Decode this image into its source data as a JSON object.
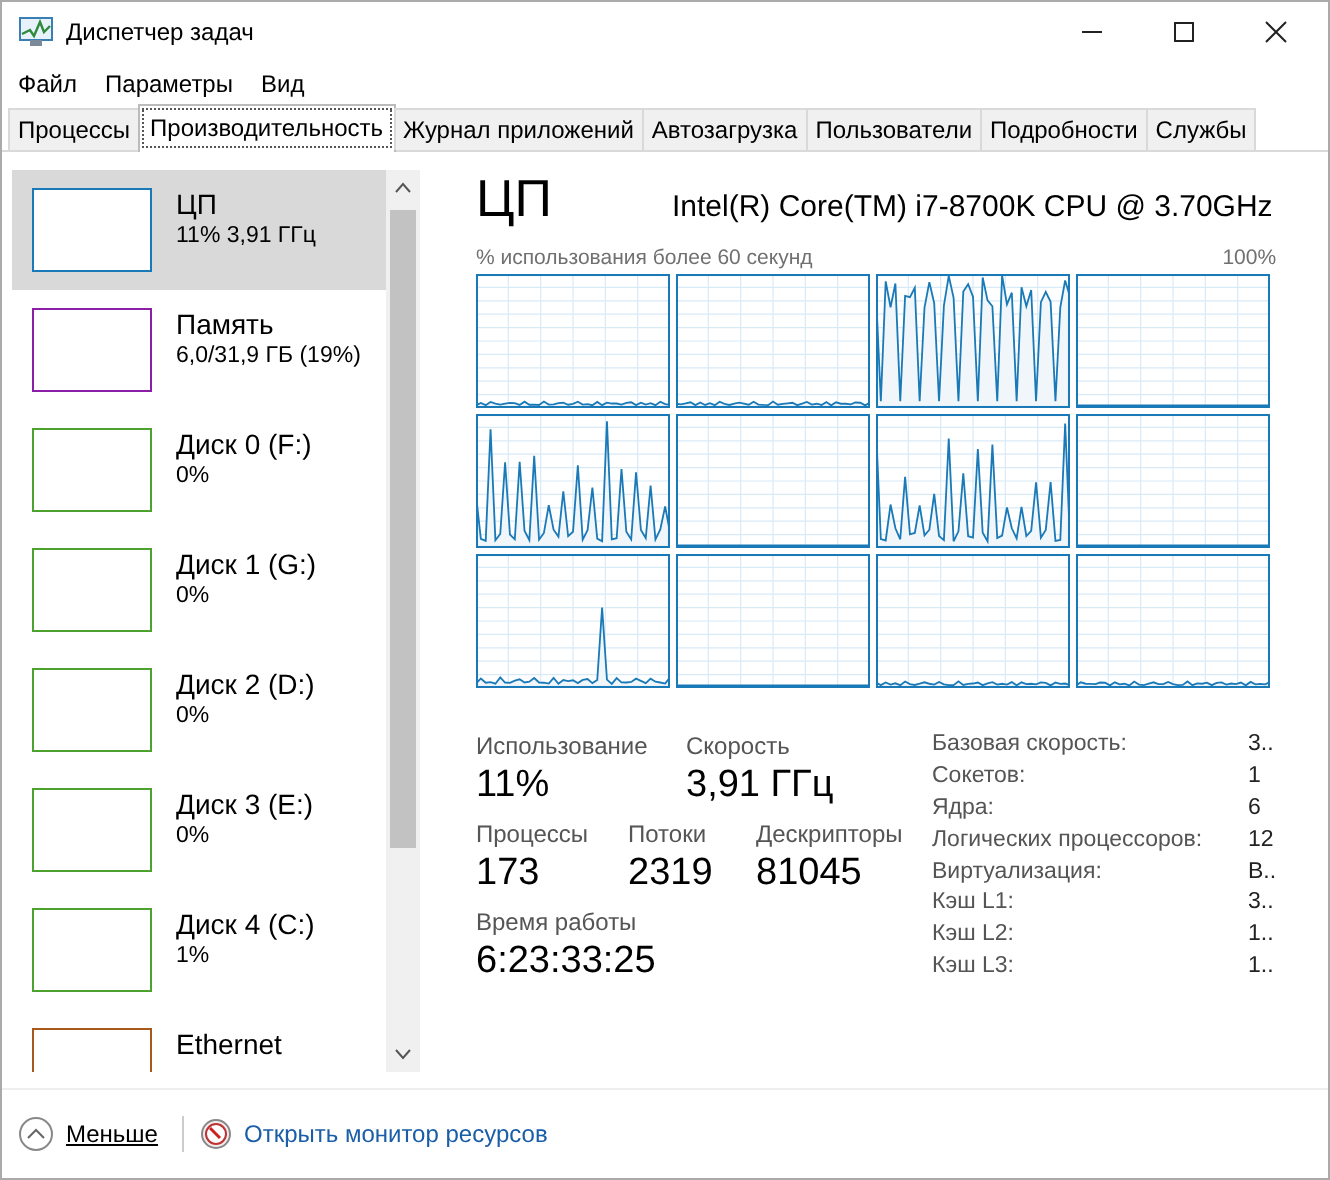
{
  "window": {
    "title": "Диспетчер задач"
  },
  "menu": [
    "Файл",
    "Параметры",
    "Вид"
  ],
  "tabs": [
    {
      "label": "Процессы",
      "selected": false
    },
    {
      "label": "Производительность",
      "selected": true
    },
    {
      "label": "Журнал приложений",
      "selected": false
    },
    {
      "label": "Автозагрузка",
      "selected": false
    },
    {
      "label": "Пользователи",
      "selected": false
    },
    {
      "label": "Подробности",
      "selected": false
    },
    {
      "label": "Службы",
      "selected": false
    }
  ],
  "sidebar": {
    "items": [
      {
        "title": "ЦП",
        "subtitle": "11% 3,91 ГГц",
        "color": "#1a7ab8",
        "selected": true
      },
      {
        "title": "Память",
        "subtitle": "6,0/31,9 ГБ (19%)",
        "color": "#8b1fa8",
        "selected": false
      },
      {
        "title": "Диск 0 (F:)",
        "subtitle": "0%",
        "color": "#4da12f",
        "selected": false
      },
      {
        "title": "Диск 1 (G:)",
        "subtitle": "0%",
        "color": "#4da12f",
        "selected": false
      },
      {
        "title": "Диск 2 (D:)",
        "subtitle": "0%",
        "color": "#4da12f",
        "selected": false
      },
      {
        "title": "Диск 3 (E:)",
        "subtitle": "0%",
        "color": "#4da12f",
        "selected": false
      },
      {
        "title": "Диск 4 (C:)",
        "subtitle": "1%",
        "color": "#4da12f",
        "selected": false
      },
      {
        "title": "Ethernet",
        "color": "#a7591a",
        "selected": false
      }
    ]
  },
  "detail": {
    "title": "ЦП",
    "model": "Intel(R) Core(TM) i7-8700K CPU @ 3.70GHz",
    "graph_caption": "% использования более 60 секунд",
    "graph_max": "100%",
    "stats": [
      {
        "label": "Использование",
        "value": "11%"
      },
      {
        "label": "Скорость",
        "value": "3,91 ГГц"
      }
    ],
    "counts": [
      {
        "label": "Процессы",
        "value": "173"
      },
      {
        "label": "Потоки",
        "value": "2319"
      },
      {
        "label": "Дескрипторы",
        "value": "81045"
      }
    ],
    "uptime": {
      "label": "Время работы",
      "value": "6:23:33:25"
    },
    "info": [
      {
        "label": "Базовая скорость:",
        "value": "3.."
      },
      {
        "label": "Сокетов:",
        "value": "1"
      },
      {
        "label": "Ядра:",
        "value": "6"
      },
      {
        "label": "Логических процессоров:",
        "value": "12"
      },
      {
        "label": "Виртуализация:",
        "value": "В.."
      },
      {
        "label": "Кэш L1:",
        "value": "3.."
      },
      {
        "label": "Кэш L2:",
        "value": "1.."
      },
      {
        "label": "Кэш L3:",
        "value": "1.."
      }
    ]
  },
  "footer": {
    "less": "Меньше",
    "link": "Открыть монитор ресурсов"
  }
}
